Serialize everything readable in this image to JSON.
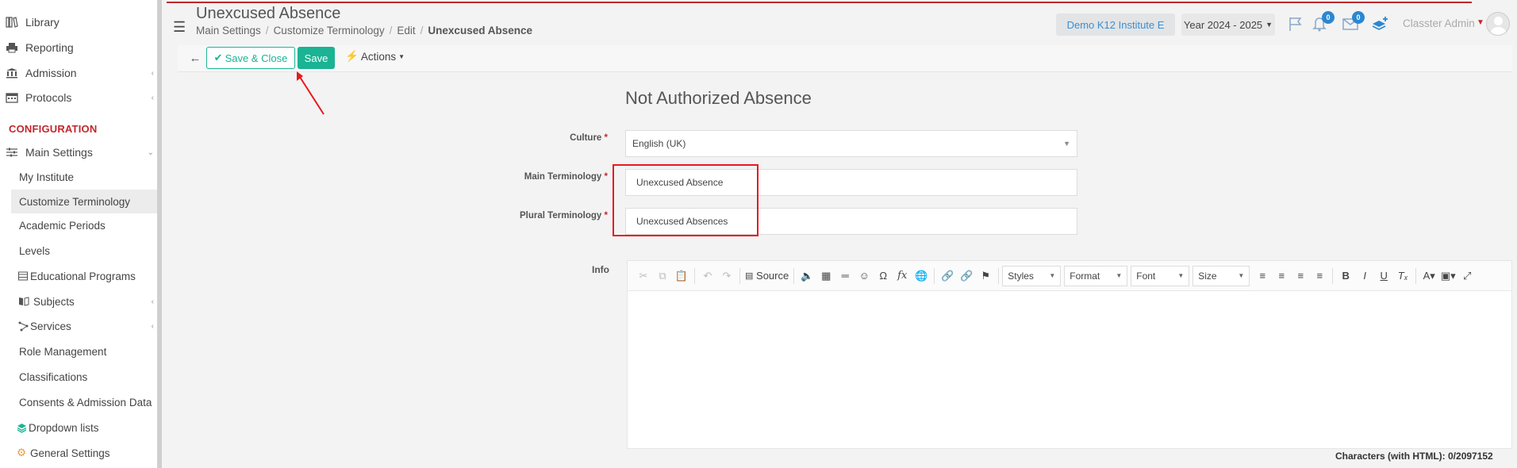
{
  "sidebar": {
    "items": [
      {
        "label": "Library",
        "icon": "books-icon"
      },
      {
        "label": "Reporting",
        "icon": "printer-icon"
      },
      {
        "label": "Admission",
        "icon": "institution-icon"
      },
      {
        "label": "Protocols",
        "icon": "calendar-grid-icon"
      }
    ],
    "section": "CONFIGURATION",
    "main_settings": "Main Settings",
    "sub_items": [
      {
        "label": "My Institute"
      },
      {
        "label": "Customize Terminology"
      },
      {
        "label": "Academic Periods"
      },
      {
        "label": "Levels"
      },
      {
        "label": "Educational Programs"
      },
      {
        "label": "Subjects"
      },
      {
        "label": "Services"
      },
      {
        "label": "Role Management"
      },
      {
        "label": "Classifications"
      },
      {
        "label": "Consents & Admission Data"
      },
      {
        "label": "Dropdown lists"
      },
      {
        "label": "General Settings"
      }
    ]
  },
  "header": {
    "title": "Unexcused Absence",
    "breadcrumb": [
      "Main Settings",
      "Customize Terminology",
      "Edit",
      "Unexcused Absence"
    ],
    "institute": "Demo K12 Institute E",
    "year": "Year 2024 - 2025",
    "notifications_count": "0",
    "messages_count": "0",
    "user": "Classter Admin"
  },
  "toolbar": {
    "save_close_label": "Save & Close",
    "save_label": "Save",
    "actions_label": "Actions"
  },
  "form": {
    "title": "Not Authorized Absence",
    "culture_label": "Culture",
    "culture_value": "English (UK)",
    "main_label": "Main Terminology",
    "main_value": "Unexcused Absence",
    "plural_label": "Plural Terminology",
    "plural_value": "Unexcused Absences",
    "info_label": "Info"
  },
  "editor": {
    "source_label": "Source",
    "styles": "Styles",
    "format": "Format",
    "font": "Font",
    "size": "Size",
    "char_count": "Characters (with HTML): 0/2097152"
  },
  "colors": {
    "accent": "#1ab394",
    "brand_red": "#c1272d",
    "highlight": "#e8191e",
    "link_blue": "#3b8fd1"
  }
}
